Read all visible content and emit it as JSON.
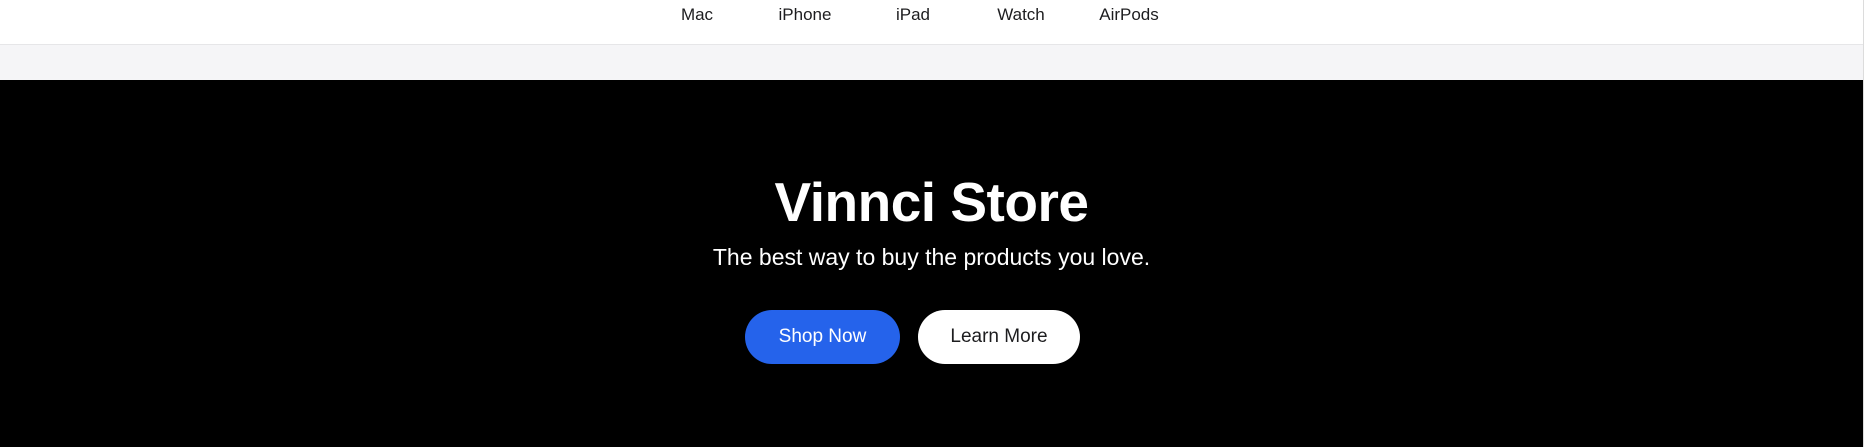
{
  "nav": {
    "items": [
      {
        "label": "Mac"
      },
      {
        "label": "iPhone"
      },
      {
        "label": "iPad"
      },
      {
        "label": "Watch"
      },
      {
        "label": "AirPods"
      }
    ]
  },
  "hero": {
    "title": "Vinnci Store",
    "subtitle": "The best way to buy the products you love.",
    "primary_button": "Shop Now",
    "secondary_button": "Learn More"
  },
  "colors": {
    "nav_background": "#ffffff",
    "sub_strip": "#f5f5f7",
    "hero_background": "#000000",
    "primary_accent": "#2563eb"
  }
}
